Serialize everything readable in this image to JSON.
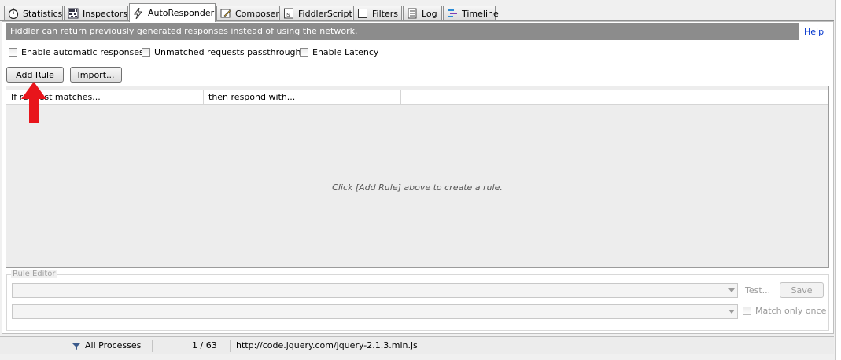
{
  "tabs": [
    {
      "label": "Statistics",
      "icon": "stopwatch-icon"
    },
    {
      "label": "Inspectors",
      "icon": "inspectors-icon"
    },
    {
      "label": "AutoResponder",
      "icon": "lightning-icon",
      "active": true
    },
    {
      "label": "Composer",
      "icon": "composer-icon"
    },
    {
      "label": "FiddlerScript",
      "icon": "script-icon"
    },
    {
      "label": "Filters",
      "icon": "filters-icon"
    },
    {
      "label": "Log",
      "icon": "log-icon"
    },
    {
      "label": "Timeline",
      "icon": "timeline-icon"
    }
  ],
  "infobar": {
    "text": "Fiddler can return previously generated responses instead of using the network.",
    "help": "Help"
  },
  "options": {
    "enable_auto": "Enable automatic responses",
    "unmatched": "Unmatched requests passthrough",
    "latency": "Enable Latency"
  },
  "buttons": {
    "add_rule": "Add Rule",
    "import": "Import..."
  },
  "list": {
    "col1": "If request matches...",
    "col2": "then respond with...",
    "empty": "Click [Add Rule] above to create a rule."
  },
  "rule_editor": {
    "label": "Rule Editor",
    "test": "Test...",
    "save": "Save",
    "match_once": "Match only once"
  },
  "status": {
    "process": "All Processes",
    "count": "1 / 63",
    "url": "http://code.jquery.com/jquery-2.1.3.min.js"
  },
  "colors": {
    "infobar": "#8c8c8c",
    "help_link": "#0033cc",
    "arrow": "#e8151b"
  }
}
